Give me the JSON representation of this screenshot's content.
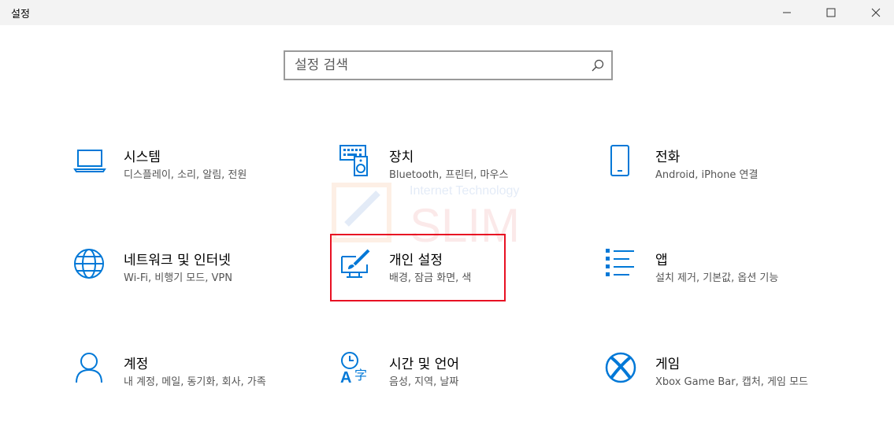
{
  "window": {
    "title": "설정"
  },
  "search": {
    "placeholder": "설정 검색"
  },
  "colors": {
    "accent": "#0078d7",
    "highlight": "#e81123"
  },
  "tiles": [
    {
      "name": "시스템",
      "desc": "디스플레이, 소리, 알림, 전원",
      "icon": "laptop-icon"
    },
    {
      "name": "장치",
      "desc": "Bluetooth, 프린터, 마우스",
      "icon": "devices-icon"
    },
    {
      "name": "전화",
      "desc": "Android, iPhone 연결",
      "icon": "phone-icon"
    },
    {
      "name": "네트워크 및 인터넷",
      "desc": "Wi-Fi, 비행기 모드, VPN",
      "icon": "globe-icon"
    },
    {
      "name": "개인 설정",
      "desc": "배경, 잠금 화면, 색",
      "icon": "personalization-icon"
    },
    {
      "name": "앱",
      "desc": "설치 제거, 기본값, 옵션 기능",
      "icon": "apps-list-icon"
    },
    {
      "name": "계정",
      "desc": "내 계정, 메일, 동기화, 회사, 가족",
      "icon": "person-icon"
    },
    {
      "name": "시간 및 언어",
      "desc": "음성, 지역, 날짜",
      "icon": "time-language-icon"
    },
    {
      "name": "게임",
      "desc": "Xbox Game Bar, 캡처, 게임 모드",
      "icon": "xbox-icon"
    }
  ],
  "watermark": {
    "line1": "Internet Technology",
    "line2": "SLIM"
  }
}
